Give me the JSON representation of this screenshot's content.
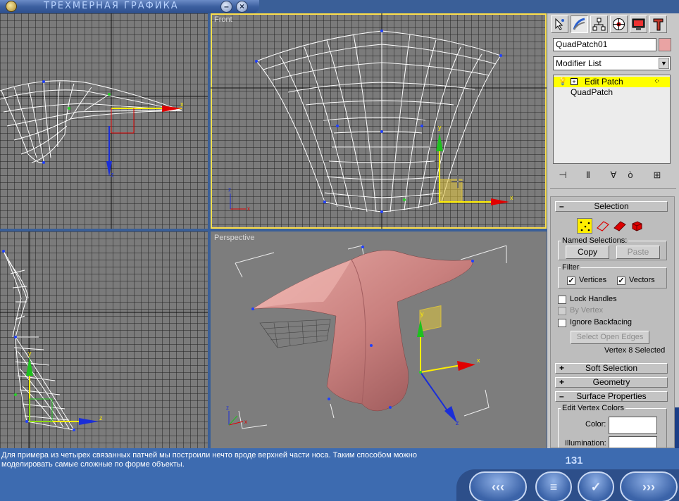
{
  "window": {
    "title": "ТРЕХМЕРНАЯ ГРАФИКА",
    "minimize_symbol": "–",
    "close_symbol": "×"
  },
  "viewports": {
    "top_left_label": "",
    "front_label": "Front",
    "left_label": "",
    "perspective_label": "Perspective"
  },
  "axes": {
    "x": "x",
    "y": "y",
    "z": "z"
  },
  "panel": {
    "tabs": [
      "create-icon",
      "modify-icon",
      "hierarchy-icon",
      "motion-icon",
      "display-icon",
      "utilities-icon"
    ],
    "object_name": "QuadPatch01",
    "object_color": "#e9a3a3",
    "modifier_list_label": "Modifier List",
    "stack": [
      {
        "label": "Edit Patch",
        "selected": true
      },
      {
        "label": "QuadPatch",
        "selected": false
      }
    ],
    "selection": {
      "title": "Selection",
      "named_selections_label": "Named Selections:",
      "copy_label": "Copy",
      "paste_label": "Paste",
      "filter_label": "Filter",
      "vertices_label": "Vertices",
      "vertices_checked": true,
      "vectors_label": "Vectors",
      "vectors_checked": true,
      "lock_handles_label": "Lock Handles",
      "by_vertex_label": "By Vertex",
      "ignore_backfacing_label": "Ignore Backfacing",
      "select_open_edges_label": "Select Open Edges",
      "status": "Vertex 8 Selected"
    },
    "soft_selection_title": "Soft Selection",
    "geometry_title": "Geometry",
    "surface_properties": {
      "title": "Surface Properties",
      "edit_vertex_colors_label": "Edit Vertex Colors",
      "color_label": "Color:",
      "illumination_label": "Illumination:"
    }
  },
  "bottom": {
    "description": "Для примера из четырех связанных патчей мы построили нечто вроде верхней части носа. Таким способом можно моделировать самые сложные по форме объекты.",
    "page_number": "131",
    "nav_prev": "‹‹‹",
    "nav_menu": "≡",
    "nav_check": "✓",
    "nav_next": "›››"
  }
}
